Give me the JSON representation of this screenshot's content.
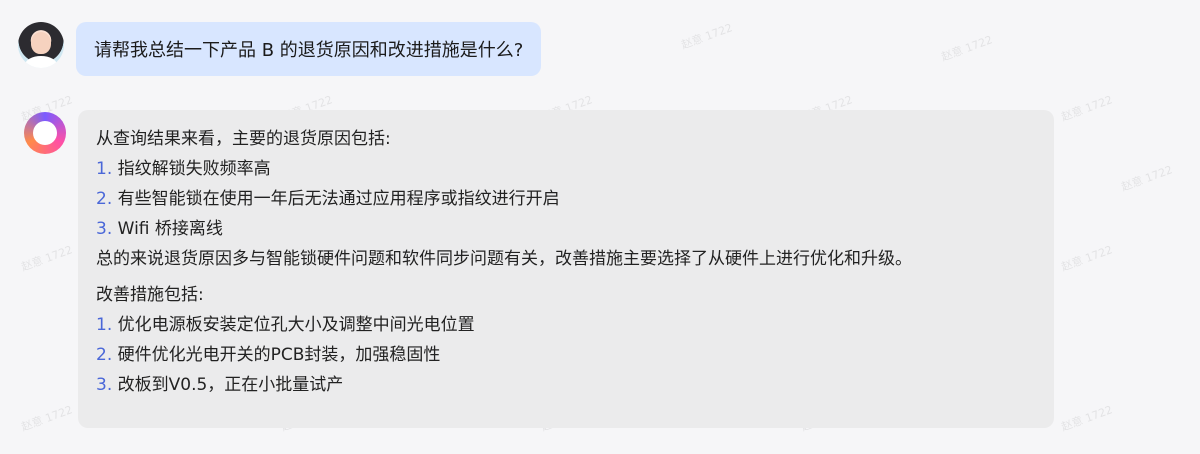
{
  "watermark_text": "赵意 1722",
  "user_message": {
    "text": "请帮我总结一下产品 B 的退货原因和改进措施是什么?"
  },
  "assistant_message": {
    "intro": "从查询结果来看，主要的退货原因包括:",
    "reasons": [
      {
        "num": "1.",
        "text": "指纹解锁失败频率高"
      },
      {
        "num": "2.",
        "text": "有些智能锁在使用一年后无法通过应用程序或指纹进行开启"
      },
      {
        "num": "3.",
        "text": "Wifi 桥接离线"
      }
    ],
    "summary": "总的来说退货原因多与智能锁硬件问题和软件同步问题有关，改善措施主要选择了从硬件上进行优化和升级。",
    "improvements_title": "改善措施包括:",
    "improvements": [
      {
        "num": "1.",
        "text": "优化电源板安装定位孔大小及调整中间光电位置"
      },
      {
        "num": "2.",
        "text": "硬件优化光电开关的PCB封装，加强稳固性"
      },
      {
        "num": "3.",
        "text": "改板到V0.5，正在小批量试产"
      }
    ]
  },
  "colors": {
    "user_bubble": "#d8e6ff",
    "assistant_bubble": "#ebebec",
    "list_number": "#4a67d8"
  }
}
